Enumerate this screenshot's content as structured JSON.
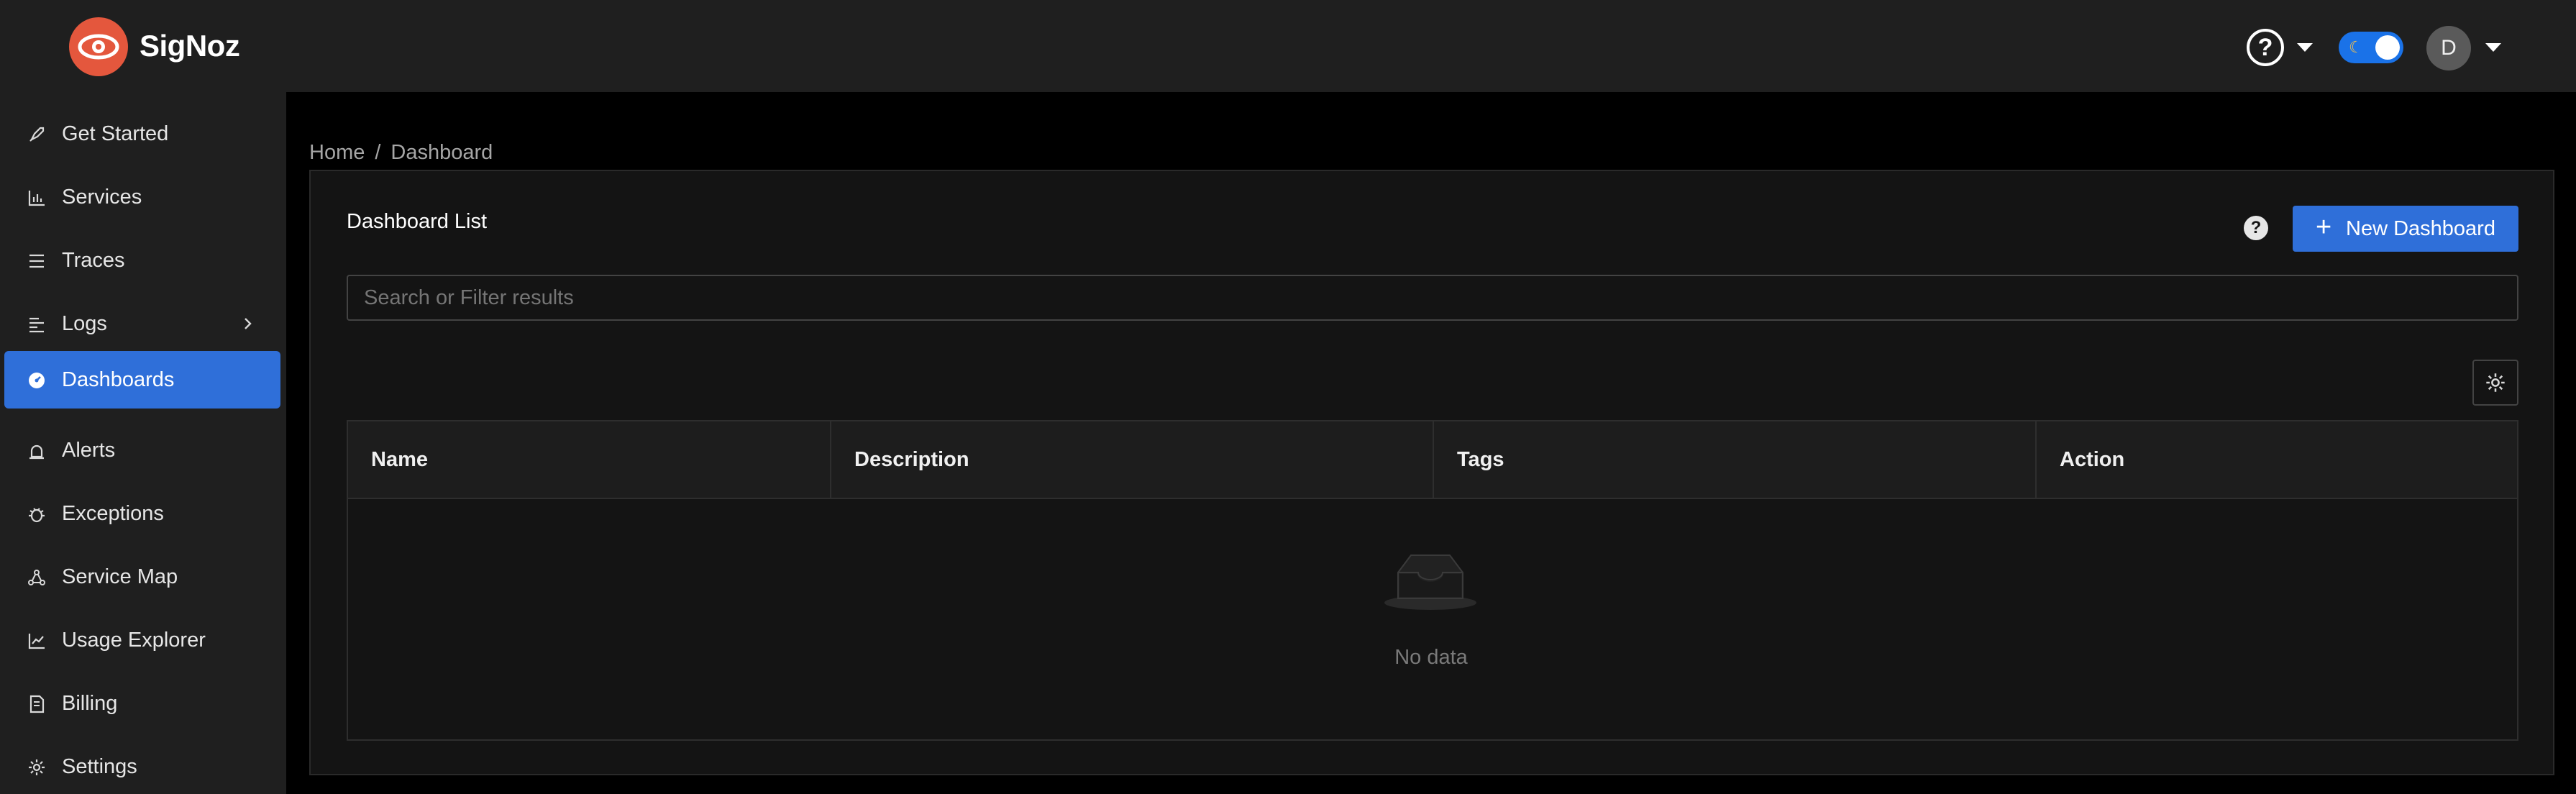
{
  "app": {
    "brand": "SigNoz",
    "help_icon": "question-circle-icon",
    "avatar_initial": "D",
    "theme_toggle": "dark"
  },
  "sidebar": {
    "items": [
      {
        "label": "Get Started",
        "icon": "rocket-icon"
      },
      {
        "label": "Services",
        "icon": "bar-chart-icon"
      },
      {
        "label": "Traces",
        "icon": "list-icon"
      },
      {
        "label": "Logs",
        "icon": "align-left-icon"
      },
      {
        "label": "Dashboards",
        "icon": "dashboard-icon",
        "active": true
      },
      {
        "label": "Alerts",
        "icon": "alarm-icon"
      },
      {
        "label": "Exceptions",
        "icon": "bug-icon"
      },
      {
        "label": "Service Map",
        "icon": "deployment-icon"
      },
      {
        "label": "Usage Explorer",
        "icon": "line-chart-icon"
      },
      {
        "label": "Billing",
        "icon": "file-icon"
      },
      {
        "label": "Settings",
        "icon": "gear-icon"
      }
    ]
  },
  "breadcrumb": {
    "home": "Home",
    "separator": "/",
    "current": "Dashboard"
  },
  "panel": {
    "title": "Dashboard List",
    "new_button_label": "New Dashboard",
    "search_placeholder": "Search or Filter results"
  },
  "table": {
    "columns": [
      "Name",
      "Description",
      "Tags",
      "Action"
    ],
    "rows": [],
    "empty_text": "No data"
  },
  "colors": {
    "accent": "#2f6fd9",
    "brand": "#e4573d",
    "header_bg": "#1f1f1f",
    "page_bg": "#000000"
  }
}
